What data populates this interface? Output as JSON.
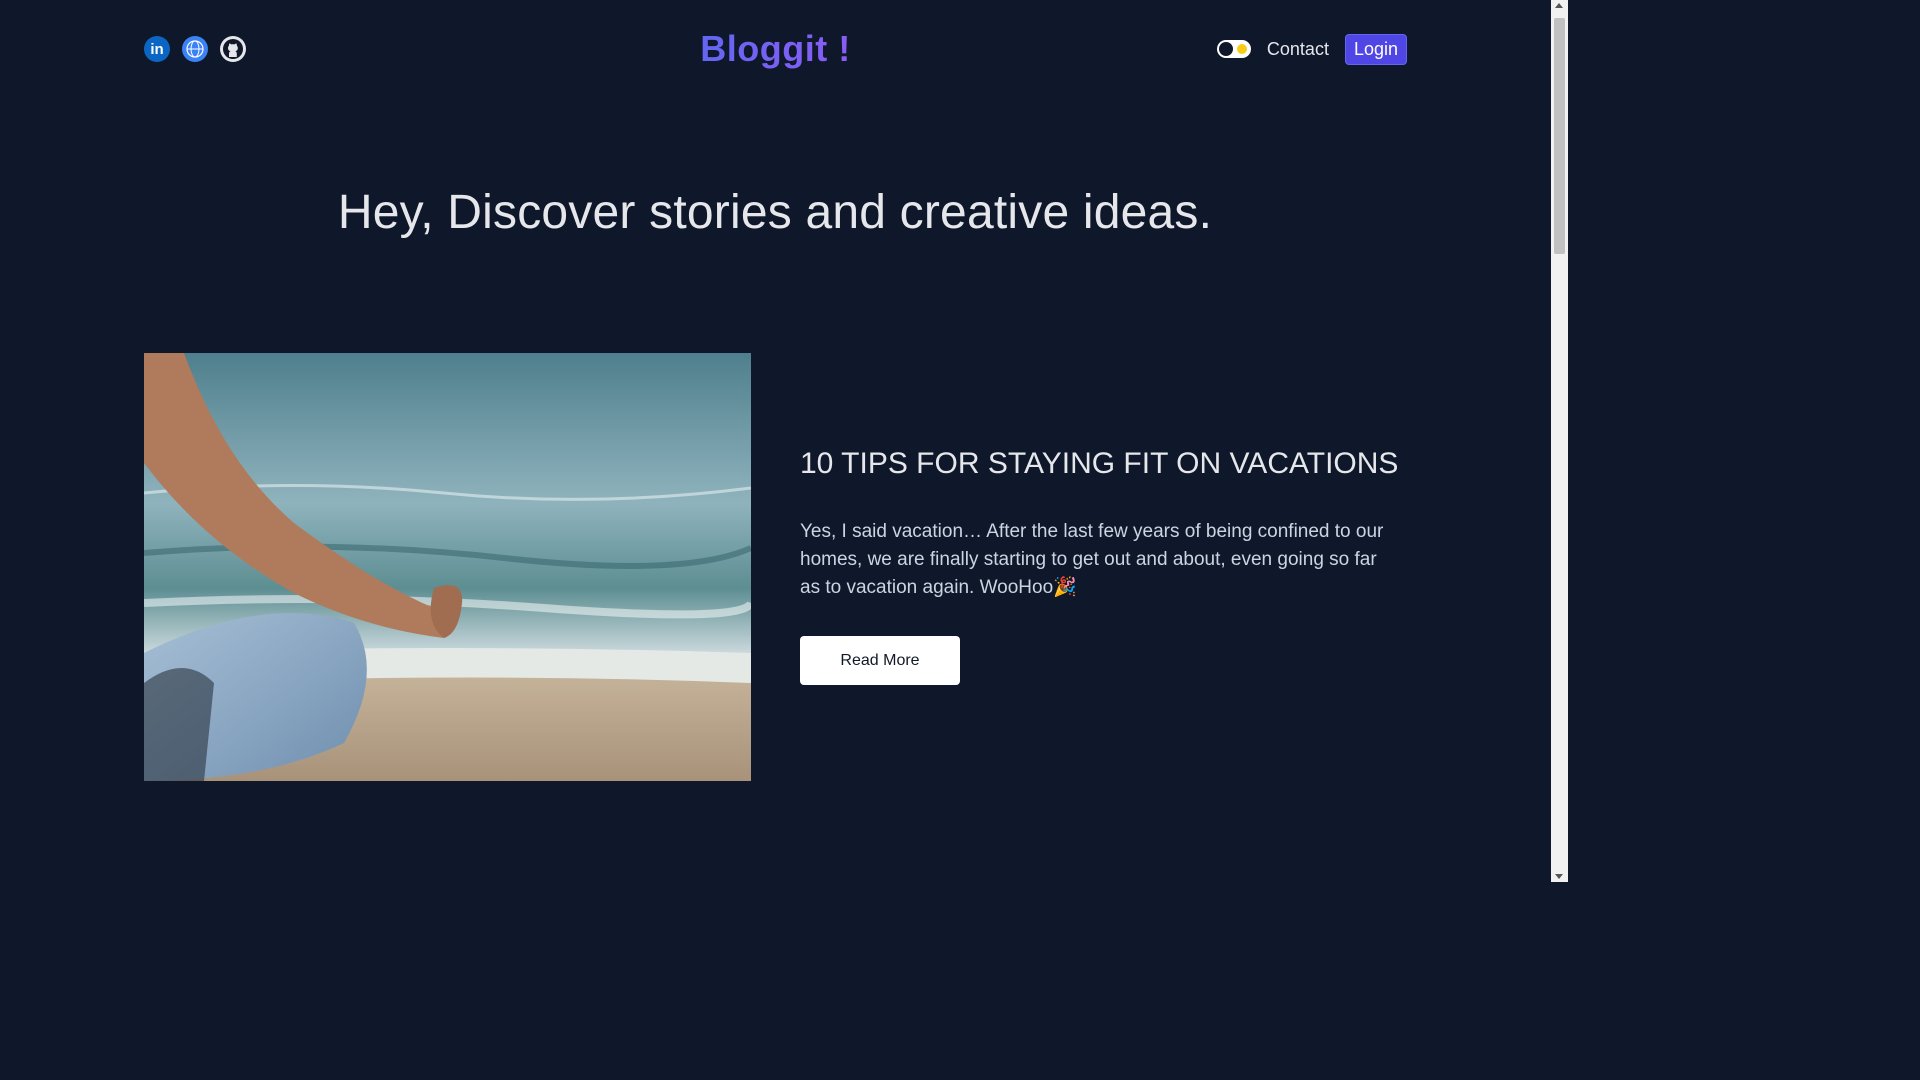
{
  "header": {
    "brand": "Bloggit !",
    "contact_label": "Contact",
    "login_label": "Login",
    "social_icons": [
      "linkedin-icon",
      "www-globe-icon",
      "github-icon"
    ]
  },
  "hero": {
    "headline": "Hey, Discover stories and creative ideas."
  },
  "featured_post": {
    "title": "10 TIPS FOR STAYING FIT ON VACATIONS",
    "excerpt": "Yes, I said vacation… After the last few years of being confined to our homes, we are finally starting to get out and about, even going so far as to vacation again. WooHoo🎉",
    "read_more_label": "Read More"
  },
  "colors": {
    "background": "#0f172a",
    "brand_gradient_start": "#6366f1",
    "brand_gradient_end": "#8b5cf6",
    "login_bg": "#4f46e5"
  }
}
